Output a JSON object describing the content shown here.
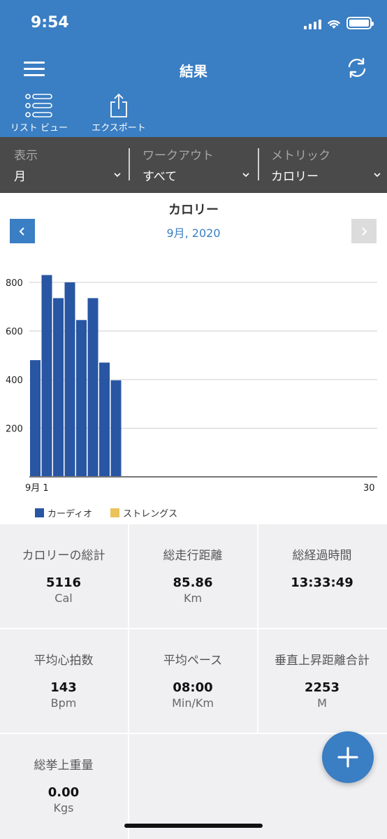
{
  "status": {
    "time": "9:54"
  },
  "header": {
    "title": "結果",
    "list_view_label": "リスト ビュー",
    "export_label": "エクスポート"
  },
  "filters": [
    {
      "label": "表示",
      "value": "月"
    },
    {
      "label": "ワークアウト",
      "value": "すべて"
    },
    {
      "label": "メトリック",
      "value": "カロリー"
    }
  ],
  "chart_header": {
    "title": "カロリー",
    "period": "9月, 2020"
  },
  "chart_data": {
    "type": "bar",
    "title": "カロリー",
    "x_start_label": "9月 1",
    "x_end_label": "30",
    "y_ticks": [
      200,
      400,
      600,
      800
    ],
    "ylim": [
      0,
      880
    ],
    "x_range": [
      1,
      30
    ],
    "categories": [
      1,
      2,
      3,
      4,
      5,
      6,
      7,
      8
    ],
    "series": [
      {
        "name": "カーディオ",
        "color": "#2856a3",
        "values": [
          480,
          830,
          735,
          800,
          645,
          735,
          470,
          397
        ]
      },
      {
        "name": "ストレングス",
        "color": "#ecc35a",
        "values": [
          0,
          0,
          0,
          0,
          0,
          0,
          0,
          0
        ]
      }
    ],
    "grid": true,
    "legend": "bottom-left"
  },
  "stats": [
    {
      "label": "カロリーの総計",
      "value": "5116",
      "unit": "Cal"
    },
    {
      "label": "総走行距離",
      "value": "85.86",
      "unit": "Km"
    },
    {
      "label": "総経過時間",
      "value": "13:33:49",
      "unit": ""
    },
    {
      "label": "平均心拍数",
      "value": "143",
      "unit": "Bpm"
    },
    {
      "label": "平均ペース",
      "value": "08:00",
      "unit": "Min/Km"
    },
    {
      "label": "垂直上昇距離合計",
      "value": "2253",
      "unit": "M"
    },
    {
      "label": "総挙上重量",
      "value": "0.00",
      "unit": "Kgs"
    }
  ],
  "colors": {
    "brand": "#3a7ec3",
    "filter_bar": "#4a4a4a",
    "bar_cardio": "#2856a3",
    "bar_strength": "#ecc35a"
  },
  "icons": {
    "menu": "hamburger-icon",
    "refresh": "refresh-icon",
    "list": "list-view-icon",
    "export": "share-icon",
    "fab": "plus-icon"
  }
}
